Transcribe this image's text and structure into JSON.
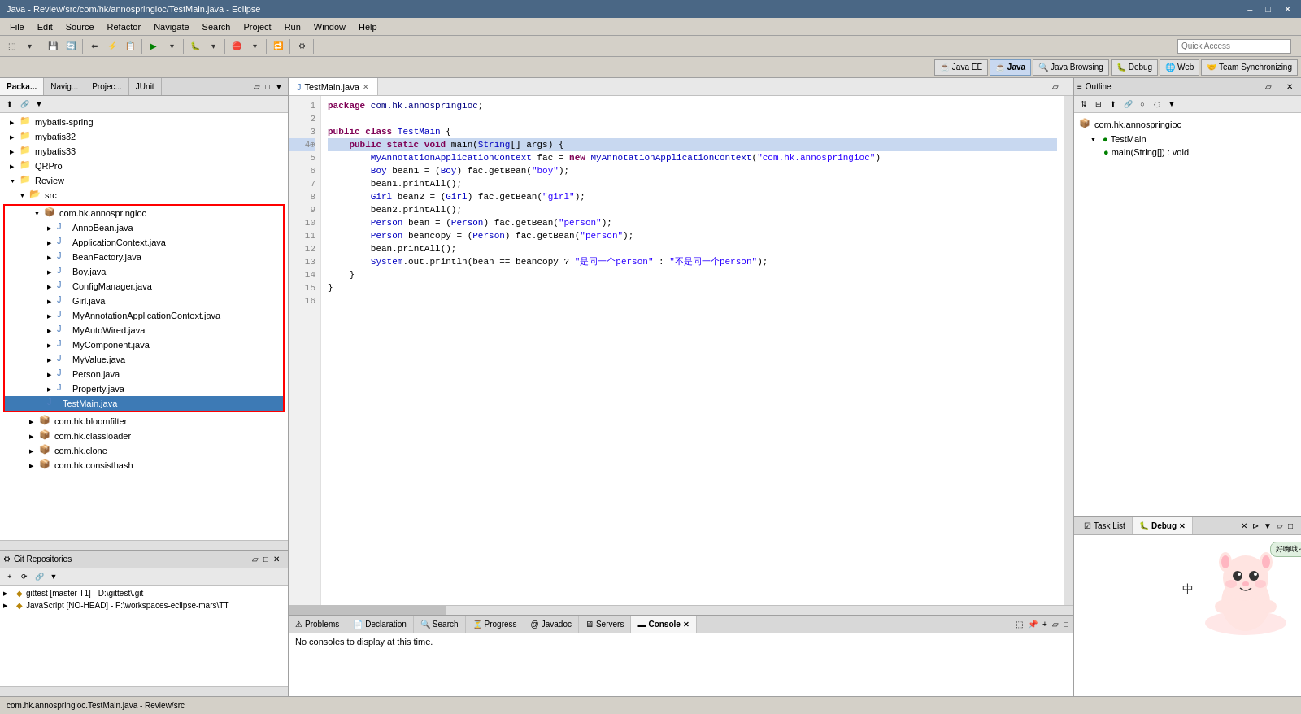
{
  "window": {
    "title": "Java - Review/src/com/hk/annospringioc/TestMain.java - Eclipse",
    "min_btn": "–",
    "max_btn": "□",
    "close_btn": "✕"
  },
  "menu": {
    "items": [
      "File",
      "Edit",
      "Source",
      "Refactor",
      "Navigate",
      "Search",
      "Project",
      "Run",
      "Window",
      "Help"
    ]
  },
  "quickaccess": {
    "label": "Quick Access",
    "placeholder": "Quick Access"
  },
  "perspectives": {
    "items": [
      {
        "id": "javaee",
        "label": "Java EE",
        "active": false
      },
      {
        "id": "java",
        "label": "Java",
        "active": true
      },
      {
        "id": "javabrowsing",
        "label": "Java Browsing",
        "active": false
      },
      {
        "id": "debug",
        "label": "Debug",
        "active": false
      },
      {
        "id": "web",
        "label": "Web",
        "active": false
      },
      {
        "id": "teamsync",
        "label": "Team Synchronizing",
        "active": false
      }
    ]
  },
  "left_panel": {
    "tabs": [
      {
        "id": "package",
        "label": "Packa...",
        "active": true
      },
      {
        "id": "navigator",
        "label": "Navig..."
      },
      {
        "id": "project",
        "label": "Projec..."
      },
      {
        "id": "junit",
        "label": "JUnit"
      }
    ]
  },
  "tree": {
    "items": [
      {
        "label": "mybatis-spring",
        "indent": 0,
        "type": "project",
        "arrow": "▶"
      },
      {
        "label": "mybatis32",
        "indent": 0,
        "type": "project",
        "arrow": "▶"
      },
      {
        "label": "mybatis33",
        "indent": 0,
        "type": "project",
        "arrow": "▶"
      },
      {
        "label": "QRPro",
        "indent": 0,
        "type": "project",
        "arrow": "▶"
      },
      {
        "label": "Review",
        "indent": 0,
        "type": "project",
        "arrow": "▼"
      },
      {
        "label": "src",
        "indent": 1,
        "type": "folder",
        "arrow": "▼"
      }
    ],
    "highlighted_package": {
      "name": "com.hk.annospringioc",
      "files": [
        {
          "label": "AnnoBean.java",
          "type": "java",
          "arrow": "▶"
        },
        {
          "label": "ApplicationContext.java",
          "type": "java",
          "arrow": "▶"
        },
        {
          "label": "BeanFactory.java",
          "type": "java",
          "arrow": "▶"
        },
        {
          "label": "Boy.java",
          "type": "java",
          "arrow": "▶"
        },
        {
          "label": "ConfigManager.java",
          "type": "java",
          "arrow": "▶"
        },
        {
          "label": "Girl.java",
          "type": "java",
          "arrow": "▶"
        },
        {
          "label": "MyAnnotationApplicationContext.java",
          "type": "java",
          "arrow": "▶"
        },
        {
          "label": "MyAutoWired.java",
          "type": "java",
          "arrow": "▶"
        },
        {
          "label": "MyComponent.java",
          "type": "java",
          "arrow": "▶"
        },
        {
          "label": "MyValue.java",
          "type": "java",
          "arrow": "▶"
        },
        {
          "label": "Person.java",
          "type": "java",
          "arrow": "▶"
        },
        {
          "label": "Property.java",
          "type": "java",
          "arrow": "▶"
        },
        {
          "label": "TestMain.java",
          "type": "java",
          "selected": true
        }
      ]
    },
    "more_packages": [
      {
        "label": "com.hk.bloomfilter",
        "indent": 2,
        "type": "package",
        "arrow": "▶"
      },
      {
        "label": "com.hk.classloader",
        "indent": 2,
        "type": "package",
        "arrow": "▶"
      },
      {
        "label": "com.hk.clone",
        "indent": 2,
        "type": "package",
        "arrow": "▶"
      },
      {
        "label": "com.hk.consisthash",
        "indent": 2,
        "type": "package",
        "arrow": "▶"
      }
    ]
  },
  "git_repos": {
    "title": "Git Repositories",
    "items": [
      {
        "label": "gittest [master T1] - D:\\gittest\\.git",
        "type": "git",
        "arrow": "▶"
      },
      {
        "label": "JavaScript [NO-HEAD] - F:\\workspaces-eclipse-mars\\TT",
        "type": "git",
        "arrow": "▶"
      }
    ]
  },
  "editor": {
    "tab": {
      "label": "TestMain.java",
      "close": "✕"
    },
    "code": {
      "lines": [
        {
          "num": "1",
          "text": "package com.hk.annospringioc;"
        },
        {
          "num": "2",
          "text": ""
        },
        {
          "num": "3",
          "text": "public class TestMain {"
        },
        {
          "num": "4",
          "text": "    public static void main(String[] args) {",
          "selected": true
        },
        {
          "num": "5",
          "text": "        MyAnnotationApplicationContext fac = new MyAnnotationApplicationContext(\"com.hk.annospringioc\")"
        },
        {
          "num": "6",
          "text": "        Boy bean1 = (Boy) fac.getBean(\"boy\");"
        },
        {
          "num": "7",
          "text": "        bean1.printAll();"
        },
        {
          "num": "8",
          "text": "        Girl bean2 = (Girl) fac.getBean(\"girl\");"
        },
        {
          "num": "9",
          "text": "        bean2.printAll();"
        },
        {
          "num": "10",
          "text": "        Person bean = (Person) fac.getBean(\"person\");"
        },
        {
          "num": "11",
          "text": "        Person beancopy = (Person) fac.getBean(\"person\");"
        },
        {
          "num": "12",
          "text": "        bean.printAll();"
        },
        {
          "num": "13",
          "text": "        System.out.println(bean == beancopy ? \"是同一个person\" : \"不是同一个person\");"
        },
        {
          "num": "14",
          "text": "    }"
        },
        {
          "num": "15",
          "text": "}"
        },
        {
          "num": "16",
          "text": ""
        }
      ]
    }
  },
  "console": {
    "tabs": [
      {
        "id": "problems",
        "label": "Problems"
      },
      {
        "id": "declaration",
        "label": "Declaration"
      },
      {
        "id": "search",
        "label": "Search"
      },
      {
        "id": "progress",
        "label": "Progress"
      },
      {
        "id": "javadoc",
        "label": "Javadoc"
      },
      {
        "id": "servers",
        "label": "Servers"
      },
      {
        "id": "console",
        "label": "Console",
        "active": true
      }
    ],
    "message": "No consoles to display at this time."
  },
  "outline": {
    "title": "Outline",
    "items": [
      {
        "label": "com.hk.annospringioc",
        "type": "package",
        "indent": 0
      },
      {
        "label": "TestMain",
        "type": "class",
        "indent": 1,
        "expanded": true
      },
      {
        "label": "main(String[]) : void",
        "type": "method",
        "indent": 2
      }
    ]
  },
  "task_panel": {
    "tabs": [
      {
        "id": "tasklist",
        "label": "Task List"
      },
      {
        "id": "debug",
        "label": "Debug",
        "active": true
      }
    ]
  },
  "status_bar": {
    "text": "com.hk.annospringioc.TestMain.java - Review/src"
  }
}
